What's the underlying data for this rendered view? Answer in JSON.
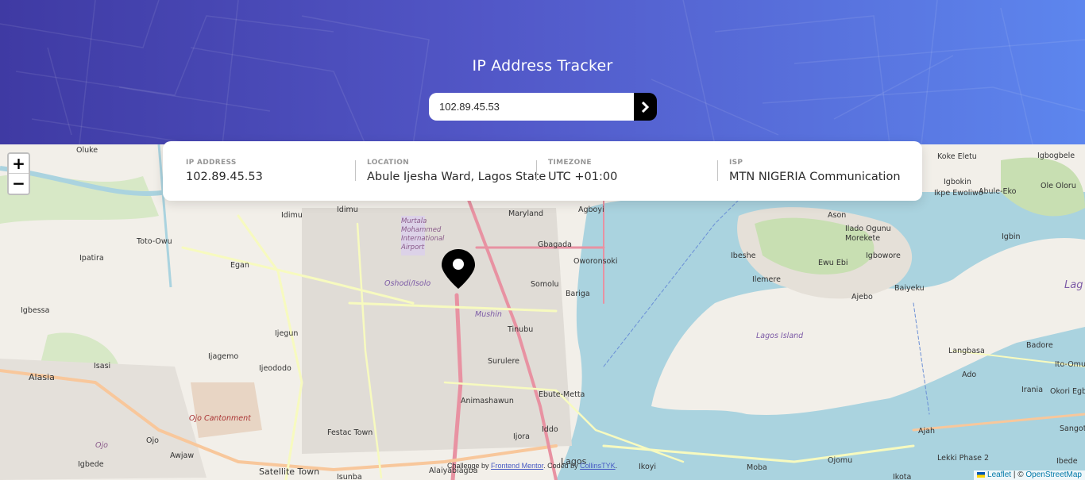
{
  "header": {
    "title": "IP Address Tracker",
    "search": {
      "value": "102.89.45.53",
      "placeholder": ""
    },
    "submit_icon": "chevron-right-icon"
  },
  "info": [
    {
      "label": "IP ADDRESS",
      "value": "102.89.45.53"
    },
    {
      "label": "LOCATION",
      "value": "Abule Ijesha Ward, Lagos State"
    },
    {
      "label": "TIMEZONE",
      "value": "UTC +01:00"
    },
    {
      "label": "ISP",
      "value": "MTN NIGERIA Communication"
    }
  ],
  "map": {
    "zoom_in": "+",
    "zoom_out": "−",
    "places": [
      "Oluke",
      "Idimu",
      "Idimu",
      "Maryland",
      "Agboyi",
      "Toto-Owu",
      "Ipatira",
      "Egan",
      "Murtala Mohammed International Airport",
      "Gbagada",
      "Oworonsoki",
      "Oshodi/Isolo",
      "Somolu",
      "Bariga",
      "Igbessa",
      "Mushin",
      "Tinubu",
      "Ijegun",
      "Ijagemo",
      "Isasi",
      "Ijeododo",
      "Alasia",
      "Surulere",
      "Ojo Cantonment",
      "Ebute-Metta",
      "Animashawun",
      "Festac Town",
      "Ijora",
      "Iddo",
      "Ojo",
      "Ojo",
      "Awjaw",
      "Igbede",
      "Satellite Town",
      "Isunba",
      "Alaiyabiagba",
      "Lagos",
      "Ikoyi",
      "Lagos Island",
      "Koke Eletu",
      "Igbogbele",
      "Igbokin",
      "Ikpe Ewoliwo",
      "Abule-Eko",
      "Ole Oloru",
      "Ason",
      "Ilado Ogunu",
      "Morekete",
      "Igbin",
      "Ibeshe",
      "Ewu Ebi",
      "Igbowore",
      "Ilemere",
      "Ajebo",
      "Baiyeku",
      "Lag",
      "Langbasa",
      "Badore",
      "Ado",
      "Ito-Omu",
      "Irania",
      "Okori Egbori",
      "Ajah",
      "Sangote",
      "Lekki Phase 2",
      "Moba",
      "Ojomu",
      "Ikota",
      "Ibede"
    ],
    "credit_prefix": "Challenge by ",
    "credit_link1": "Frontend Mentor",
    "credit_mid": ". Coded by ",
    "credit_link2": "CollinsTYK",
    "credit_suffix": ".",
    "attribution_leaflet": "Leaflet",
    "attribution_sep": " | © ",
    "attribution_osm": "OpenStreetMap"
  },
  "colors": {
    "header_gradient_start": "#3f3aa3",
    "header_gradient_end": "#5d86ee",
    "water": "#aad3df",
    "land": "#f2efe9",
    "marker": "#000000"
  }
}
